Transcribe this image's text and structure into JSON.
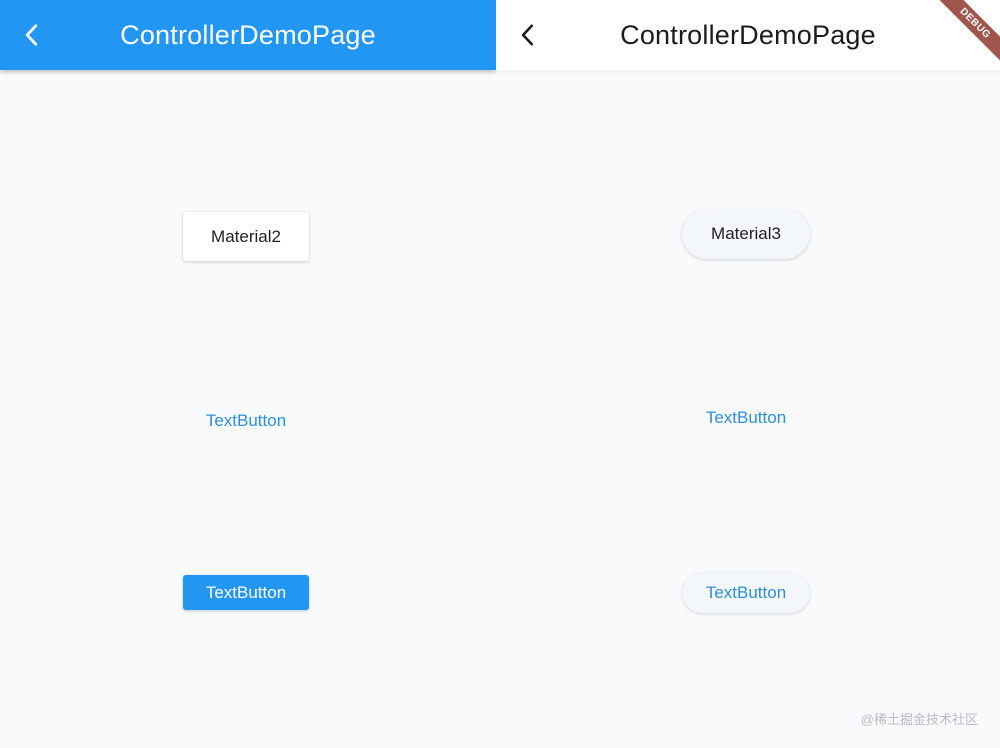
{
  "left_pane": {
    "appbar": {
      "title": "ControllerDemoPage",
      "background": "#2196f3",
      "back_icon": "arrow-back-ios-icon"
    },
    "buttons": {
      "elevated_label": "Material2",
      "text_label": "TextButton",
      "filled_label": "TextButton"
    }
  },
  "right_pane": {
    "appbar": {
      "title": "ControllerDemoPage",
      "background": "#ffffff",
      "back_icon": "arrow-back-ios-icon"
    },
    "buttons": {
      "elevated_label": "Material3",
      "text_label": "TextButton",
      "elevated_text_label": "TextButton"
    }
  },
  "debug_banner": {
    "label": "DEBUG",
    "color": "#a0564e"
  },
  "watermark": "@稀土掘金技术社区",
  "colors": {
    "primary": "#2196f3",
    "link_text": "#2a8fe0",
    "page_background": "#f9fafb"
  }
}
